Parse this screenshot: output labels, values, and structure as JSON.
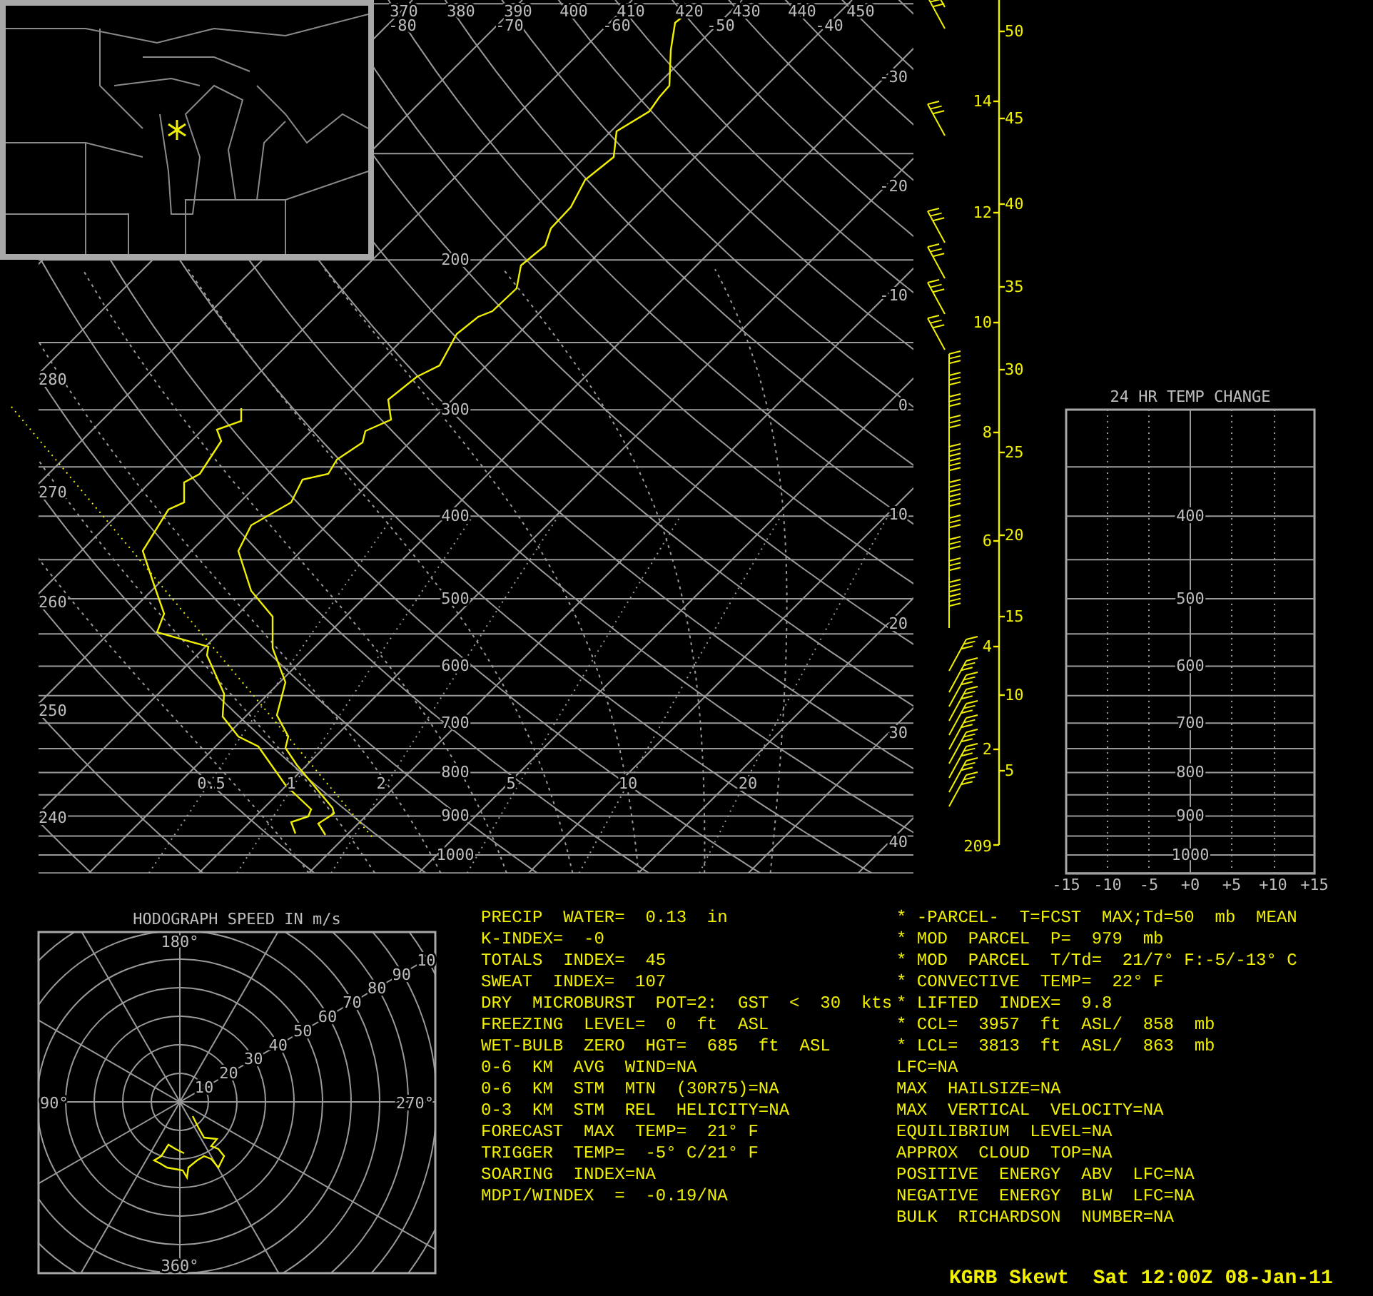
{
  "skewt": {
    "top_theta_labels": [
      "370",
      "380",
      "390",
      "400",
      "410",
      "420",
      "430",
      "440",
      "450"
    ],
    "top_temp_labels": [
      "-80",
      "-70",
      "-60",
      "-50",
      "-40"
    ],
    "pressure_labels": [
      "200",
      "300",
      "400",
      "500",
      "600",
      "700",
      "800",
      "900",
      "1000"
    ],
    "theta_labels": [
      "280",
      "270",
      "260",
      "250",
      "240"
    ],
    "temp_labels": [
      "-30",
      "-20",
      "-10",
      "0",
      "10",
      "20",
      "30",
      "40"
    ],
    "mixing_ratio_labels": [
      "0.5",
      "1",
      "2",
      "5",
      "10",
      "20"
    ]
  },
  "height_axis": {
    "km_labels": [
      "14",
      "12",
      "10",
      "8",
      "6",
      "4",
      "2"
    ],
    "kft_labels": [
      "50",
      "45",
      "40",
      "35",
      "30",
      "25",
      "20",
      "15",
      "10",
      "5"
    ],
    "base_label": "209"
  },
  "temp_change": {
    "title": "24 HR TEMP CHANGE",
    "pressure_labels": [
      "400",
      "500",
      "600",
      "700",
      "800",
      "900",
      "1000"
    ],
    "x_labels": [
      "-15",
      "-10",
      "-5",
      "+0",
      "+5",
      "+10",
      "+15"
    ]
  },
  "hodograph": {
    "title": "HODOGRAPH SPEED IN m/s",
    "direction_labels": [
      "180°",
      "90°",
      "270°",
      "360°"
    ],
    "speed_labels": [
      "10",
      "20",
      "30",
      "40",
      "50",
      "60",
      "70",
      "80",
      "90",
      "10"
    ]
  },
  "indices_left": [
    "PRECIP  WATER=  0.13  in",
    "K-INDEX=  -0",
    "TOTALS  INDEX=  45",
    "SWEAT  INDEX=  107",
    "DRY  MICROBURST  POT=2:  GST  <  30  kts",
    "FREEZING  LEVEL=  0  ft  ASL",
    "WET-BULB  ZERO  HGT=  685  ft  ASL",
    "0-6  KM  AVG  WIND=NA",
    "0-6  KM  STM  MTN  (30R75)=NA",
    "0-3  KM  STM  REL  HELICITY=NA",
    "FORECAST  MAX  TEMP=  21° F",
    "TRIGGER  TEMP=  -5° C/21° F",
    "SOARING  INDEX=NA",
    "MDPI/WINDEX  =  -0.19/NA"
  ],
  "indices_right": [
    "* -PARCEL-  T=FCST  MAX;Td=50  mb  MEAN",
    "* MOD  PARCEL  P=  979  mb",
    "* MOD  PARCEL  T/Td=  21/7° F:-5/-13° C",
    "* CONVECTIVE  TEMP=  22° F",
    "* LIFTED  INDEX=  9.8",
    "* CCL=  3957  ft  ASL/  858  mb",
    "* LCL=  3813  ft  ASL/  863  mb",
    "LFC=NA",
    "MAX  HAILSIZE=NA",
    "MAX  VERTICAL  VELOCITY=NA",
    "EQUILIBRIUM  LEVEL=NA",
    "APPROX  CLOUD  TOP=NA",
    "POSITIVE  ENERGY  ABV  LFC=NA",
    "NEGATIVE  ENERGY  BLW  LFC=NA",
    "BULK  RICHARDSON  NUMBER=NA"
  ],
  "footer": "KGRB Skewt  Sat 12:00Z 08-Jan-11"
}
